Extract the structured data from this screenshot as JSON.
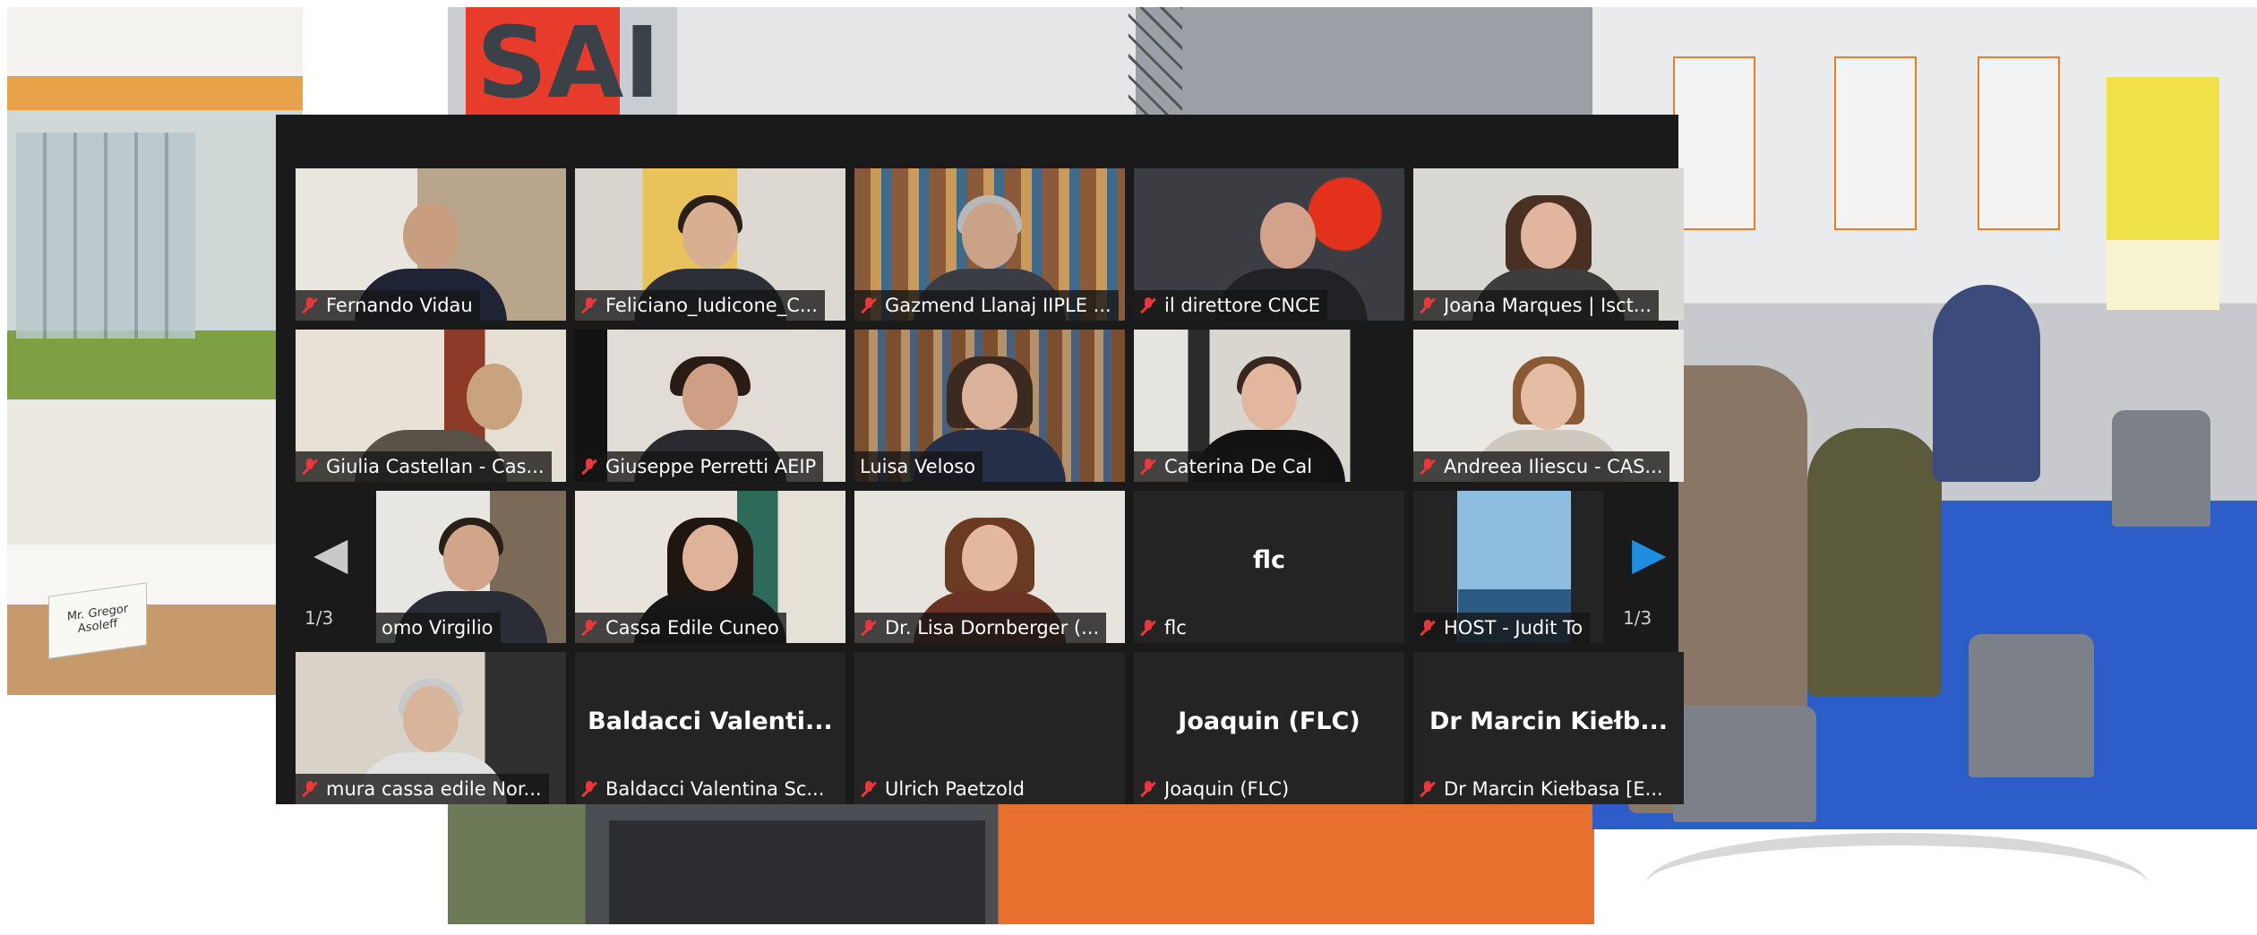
{
  "background": {
    "name_card_text": "Mr. Gregor Asoleff"
  },
  "gallery": {
    "page_indicator_left": "1/3",
    "page_indicator_right": "1/3",
    "accent_active": "#d8dd3b",
    "muted_icon_color": "#e8393a",
    "next_arrow_color": "#1e8fe0",
    "tiles": [
      {
        "name": "Fernando Vidau",
        "muted": true,
        "video": true
      },
      {
        "name": "Feliciano_Iudicone_C...",
        "muted": true,
        "video": true
      },
      {
        "name": "Gazmend Llanaj IIPLE ...",
        "muted": true,
        "video": true
      },
      {
        "name": "il direttore CNCE",
        "muted": true,
        "video": true
      },
      {
        "name": "Joana Marques | Isct...",
        "muted": true,
        "video": true
      },
      {
        "name": "Giulia Castellan - Cas...",
        "muted": true,
        "video": true
      },
      {
        "name": "Giuseppe Perretti AEIP",
        "muted": true,
        "video": true
      },
      {
        "name": "Luisa Veloso",
        "muted": false,
        "video": true,
        "active": true
      },
      {
        "name": "Caterina De Cal",
        "muted": true,
        "video": true
      },
      {
        "name": "Andreea Iliescu - CAS...",
        "muted": true,
        "video": true
      },
      {
        "name": "omo Virgilio",
        "muted": false,
        "video": true
      },
      {
        "name": "Cassa Edile Cuneo",
        "muted": true,
        "video": true
      },
      {
        "name": "Dr. Lisa Dornberger (...",
        "muted": true,
        "video": true
      },
      {
        "name": "flc",
        "muted": true,
        "video": false,
        "display": "flc"
      },
      {
        "name": "HOST - Judit To",
        "muted": true,
        "video": true
      },
      {
        "name": "mura cassa edile Nor...",
        "muted": true,
        "video": true
      },
      {
        "name": "Baldacci Valentina Sc...",
        "muted": true,
        "video": false,
        "display": "Baldacci Valenti..."
      },
      {
        "name": "Ulrich Paetzold",
        "muted": true,
        "video": false,
        "display": ""
      },
      {
        "name": "Joaquin  (FLC)",
        "muted": true,
        "video": false,
        "display": "Joaquin  (FLC)"
      },
      {
        "name": "Dr Marcin Kiełbasa [E...",
        "muted": true,
        "video": false,
        "display": "Dr Marcin Kiełb..."
      }
    ]
  }
}
